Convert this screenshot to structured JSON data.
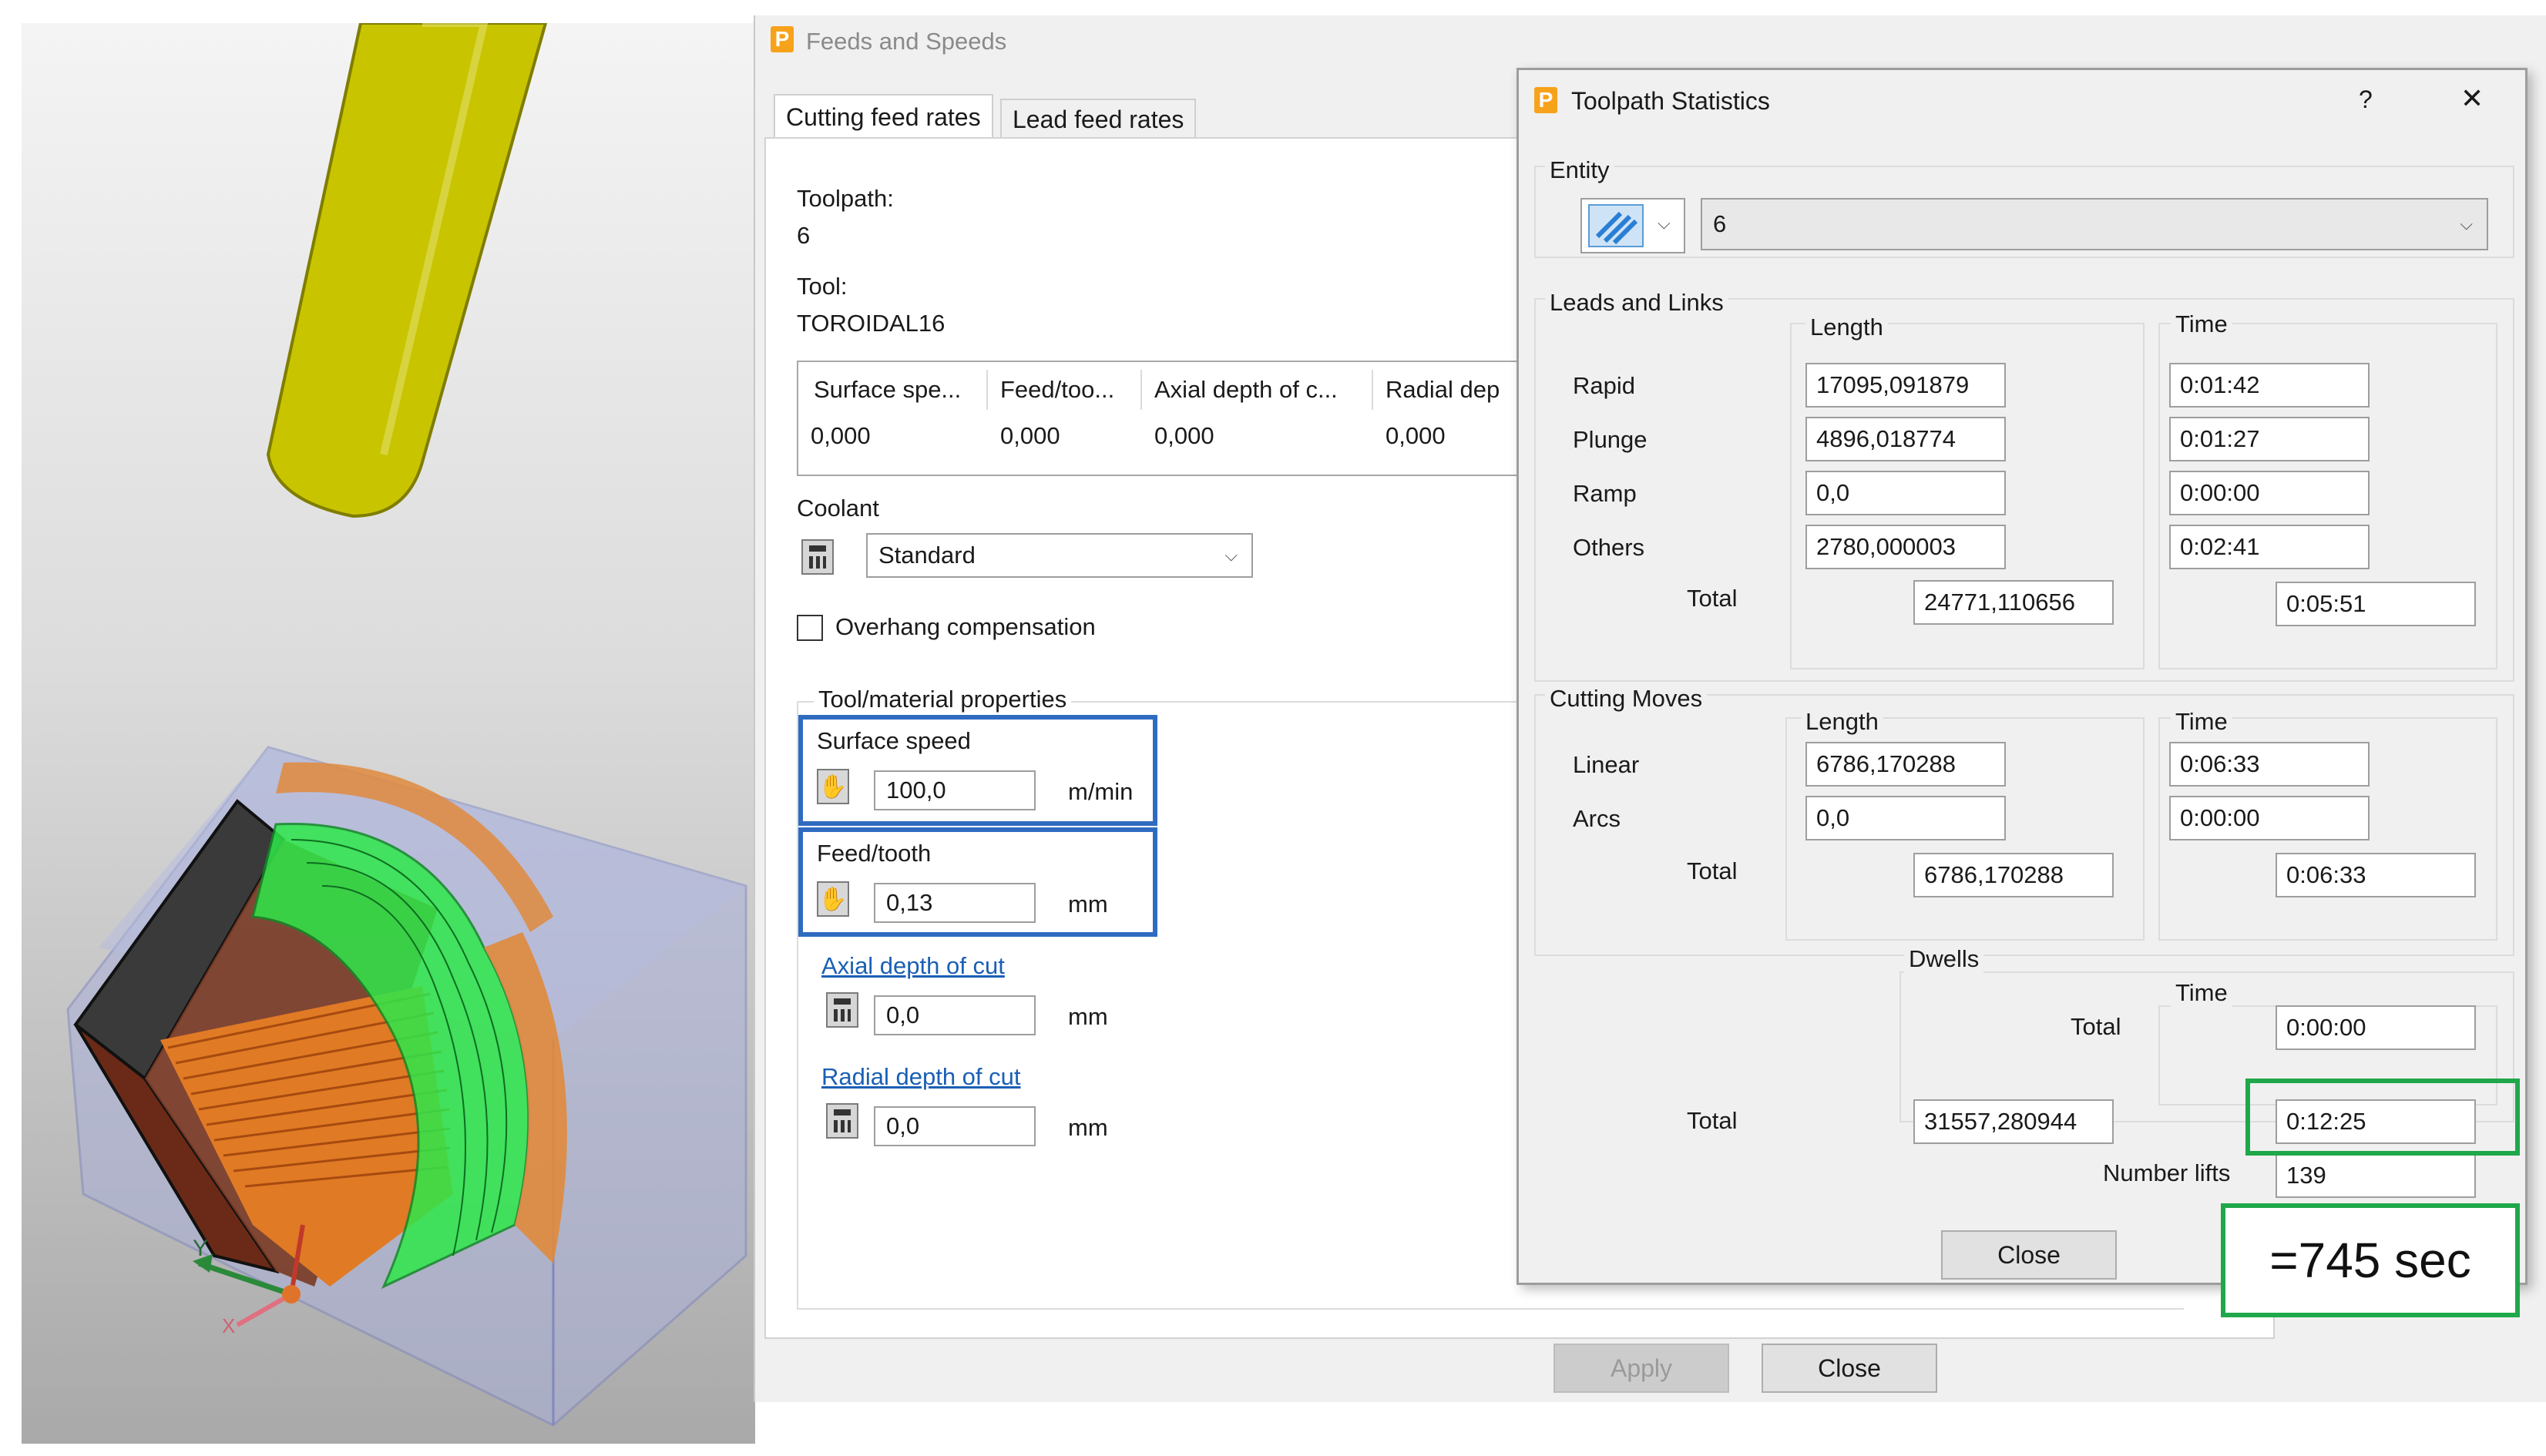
{
  "feeds": {
    "title": "Feeds and Speeds",
    "tabs": [
      "Cutting feed rates",
      "Lead feed rates"
    ],
    "toolpath_label": "Toolpath:",
    "toolpath_value": "6",
    "tool_label": "Tool:",
    "tool_value": "TOROIDAL16",
    "table": {
      "headers": [
        "Surface spe...",
        "Feed/too...",
        "Axial depth of c...",
        "Radial dep"
      ],
      "values": [
        "0,000",
        "0,000",
        "0,000",
        "0,000"
      ]
    },
    "coolant_label": "Coolant",
    "coolant_value": "Standard",
    "overhang_label": "Overhang compensation",
    "props_title": "Tool/material properties",
    "surface_speed_label": "Surface speed",
    "surface_speed_value": "100,0",
    "surface_speed_unit": "m/min",
    "feed_tooth_label": "Feed/tooth",
    "feed_tooth_value": "0,13",
    "feed_tooth_unit": "mm",
    "axial_label": "Axial depth of cut",
    "axial_value": "0,0",
    "axial_unit": "mm",
    "radial_label": "Radial depth of cut",
    "radial_value": "0,0",
    "radial_unit": "mm",
    "apply_label": "Apply",
    "close_label": "Close"
  },
  "stats": {
    "title": "Toolpath Statistics",
    "help": "?",
    "close_x": "✕",
    "entity_label": "Entity",
    "entity_value": "6",
    "leads": {
      "title": "Leads and Links",
      "length_header": "Length",
      "time_header": "Time",
      "rows": [
        {
          "label": "Rapid",
          "length": "17095,091879",
          "time": "0:01:42"
        },
        {
          "label": "Plunge",
          "length": "4896,018774",
          "time": "0:01:27"
        },
        {
          "label": "Ramp",
          "length": "0,0",
          "time": "0:00:00"
        },
        {
          "label": "Others",
          "length": "2780,000003",
          "time": "0:02:41"
        }
      ],
      "total_label": "Total",
      "total_length": "24771,110656",
      "total_time": "0:05:51"
    },
    "cutting": {
      "title": "Cutting Moves",
      "length_header": "Length",
      "time_header": "Time",
      "rows": [
        {
          "label": "Linear",
          "length": "6786,170288",
          "time": "0:06:33"
        },
        {
          "label": "Arcs",
          "length": "0,0",
          "time": "0:00:00"
        }
      ],
      "total_label": "Total",
      "total_length": "6786,170288",
      "total_time": "0:06:33"
    },
    "dwells": {
      "title": "Dwells",
      "time_header": "Time",
      "total_label": "Total",
      "total_time": "0:00:00"
    },
    "grand_total_label": "Total",
    "grand_total_length": "31557,280944",
    "grand_total_time": "0:12:25",
    "lifts_label": "Number lifts",
    "lifts_value": "139",
    "close_label": "Close"
  },
  "annotation": "=745 sec",
  "axes": {
    "y": "Y",
    "x": "X"
  },
  "colors": {
    "blue_highlight": "#2f6cc0",
    "green_highlight": "#1fa84a",
    "tool": "#c8c400",
    "toolpath": "#2ee84a",
    "stock_edge": "#e08a3c"
  }
}
